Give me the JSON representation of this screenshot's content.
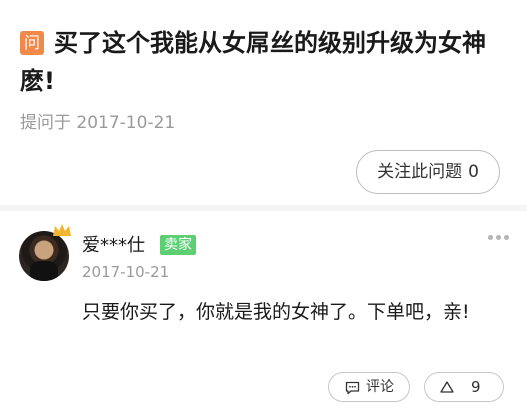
{
  "question": {
    "badge": "问",
    "title": "买了这个我能从女屌丝的级别升级为女神麽!",
    "date": "提问于 2017-10-21",
    "follow_label": "关注此问题",
    "follow_count": "0"
  },
  "answer": {
    "username": "爱***仕",
    "seller_tag": "卖家",
    "date": "2017-10-21",
    "text": "只要你买了，你就是我的女神了。下单吧，亲!",
    "comment_label": "评论",
    "vote_count": "9"
  },
  "icons": {
    "badge": "question-badge-icon",
    "avatar": "avatar-image",
    "crown": "crown-icon",
    "more": "more-dots-icon",
    "comment": "comment-icon",
    "vote": "upvote-triangle-icon"
  },
  "colors": {
    "badge": "#f0894a",
    "seller_tag": "#5ccf73",
    "crown": "#f2b531",
    "muted_text": "#9a9a9a",
    "background": "#f4f4f4"
  }
}
